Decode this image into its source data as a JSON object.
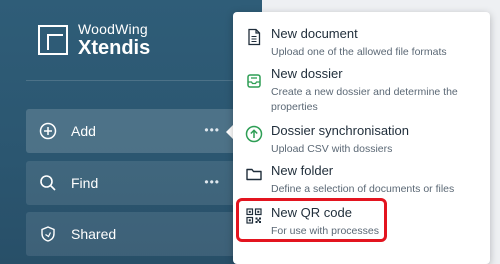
{
  "brand": {
    "line1": "WoodWing",
    "line2": "Xtendis"
  },
  "nav": {
    "add": {
      "label": "Add",
      "more": "•••"
    },
    "find": {
      "label": "Find",
      "more": "•••"
    },
    "shared": {
      "label": "Shared"
    }
  },
  "menu": {
    "items": [
      {
        "title": "New document",
        "desc": "Upload one of the allowed file formats",
        "icon": "document-icon"
      },
      {
        "title": "New dossier",
        "desc": "Create a new dossier and determine the properties",
        "icon": "dossier-icon"
      },
      {
        "title": "Dossier synchronisation",
        "desc": "Upload CSV with dossiers",
        "icon": "sync-upload-icon"
      },
      {
        "title": "New folder",
        "desc": "Define a selection of documents or files",
        "icon": "folder-icon"
      },
      {
        "title": "New QR code",
        "desc": "For use with processes",
        "icon": "qr-code-icon"
      }
    ]
  },
  "colors": {
    "sidebar": "#2f5d78",
    "accent_green": "#2e9e55",
    "highlight": "#e3141f"
  }
}
